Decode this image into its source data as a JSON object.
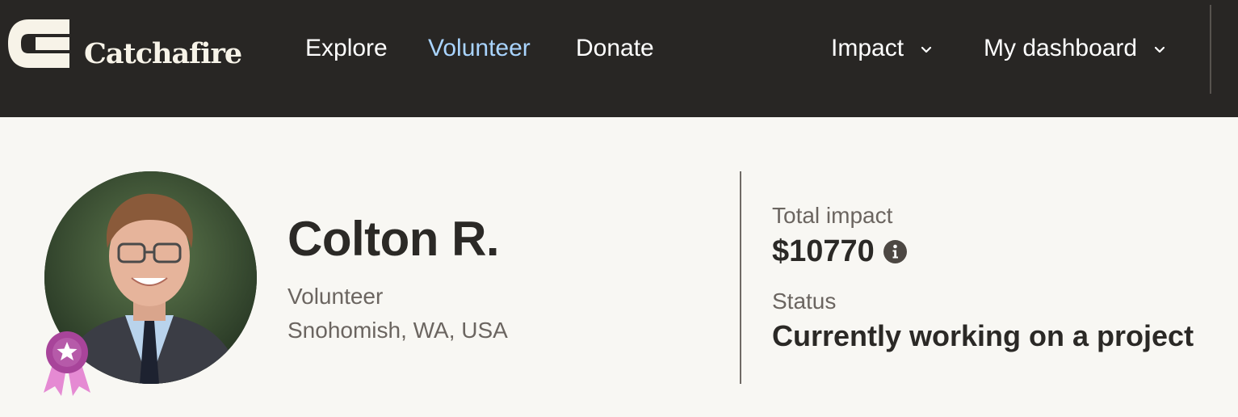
{
  "brand": {
    "name": "Catchafire",
    "logo_color": "#f7f3e8"
  },
  "nav": {
    "explore": "Explore",
    "volunteer": "Volunteer",
    "donate": "Donate",
    "impact": "Impact",
    "dashboard": "My dashboard",
    "active_item": "Volunteer",
    "active_color": "#a9d4ff"
  },
  "icons": {
    "logo": "catchafire-logo-icon",
    "chevron": "chevron-down-icon",
    "badge": "award-ribbon-icon",
    "info": "info-icon"
  },
  "profile": {
    "name": "Colton R.",
    "role": "Volunteer",
    "location": "Snohomish, WA, USA"
  },
  "stats": {
    "impact_label": "Total impact",
    "impact_value": "$10770",
    "status_label": "Status",
    "status_value": "Currently working on a project"
  },
  "colors": {
    "header_bg": "#282624",
    "page_bg": "#f8f7f3",
    "badge": "#a8449a",
    "text_primary": "#2b2926",
    "text_secondary": "#6b6560"
  }
}
